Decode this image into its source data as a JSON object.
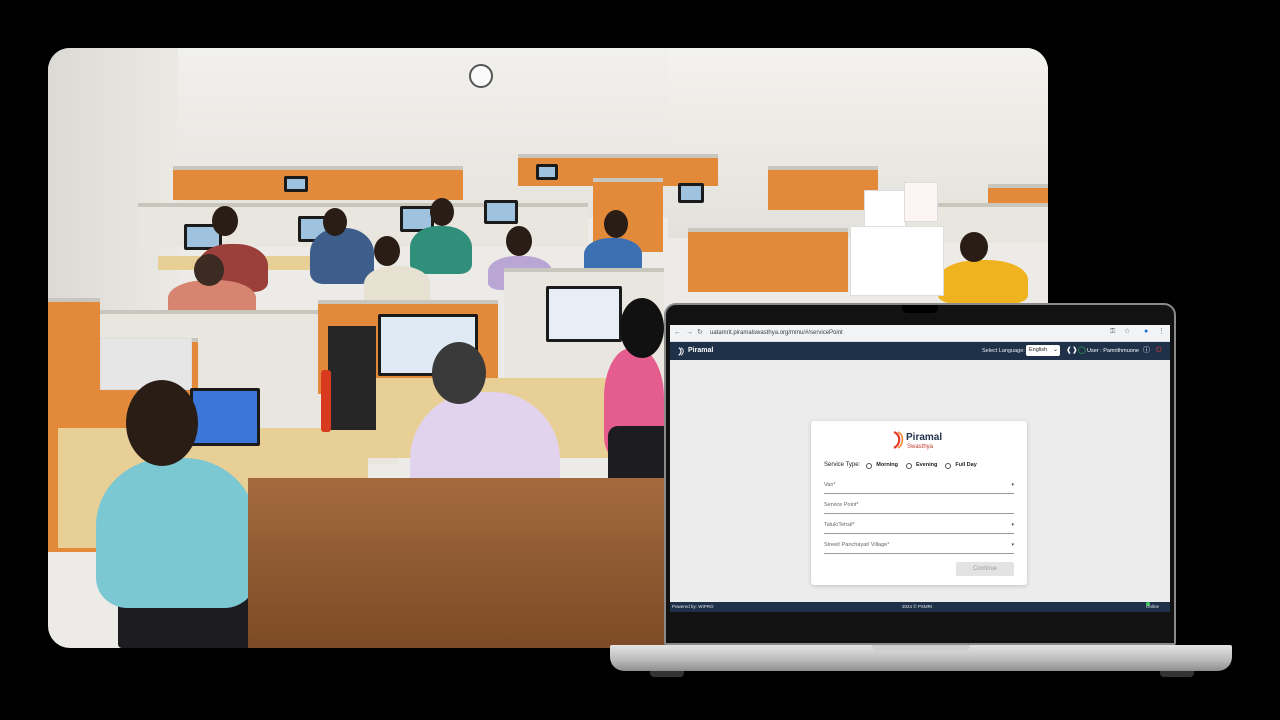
{
  "browser": {
    "url": "uatamrit.piramalswasthya.org/mmu/#/servicePoint",
    "back_icon": "arrow-left-icon",
    "forward_icon": "arrow-right-icon",
    "reload_icon": "reload-icon"
  },
  "header": {
    "brand": "Piramal",
    "select_language_label": "Select Language:",
    "language_value": "English",
    "user_label": "User : Pamrithmuone"
  },
  "form": {
    "logo_name": "Piramal",
    "logo_sub": "Swasthya",
    "service_type_label": "Service Type:",
    "options": [
      "Morning",
      "Evening",
      "Full Day"
    ],
    "fields": {
      "van": "Van*",
      "service_point": "Service Point*",
      "taluk": "Taluk/Tehsil*",
      "street": "Street/ Panchayat/ Village*"
    },
    "continue_label": "Continue"
  },
  "footer": {
    "powered_by": "Powered by: WIPRO",
    "copyright": "2024 © PSMRI",
    "status": "Online"
  },
  "colors": {
    "navy": "#1f3149",
    "brand_red": "#e23b2e",
    "cubicle_orange": "#e28a3a"
  }
}
